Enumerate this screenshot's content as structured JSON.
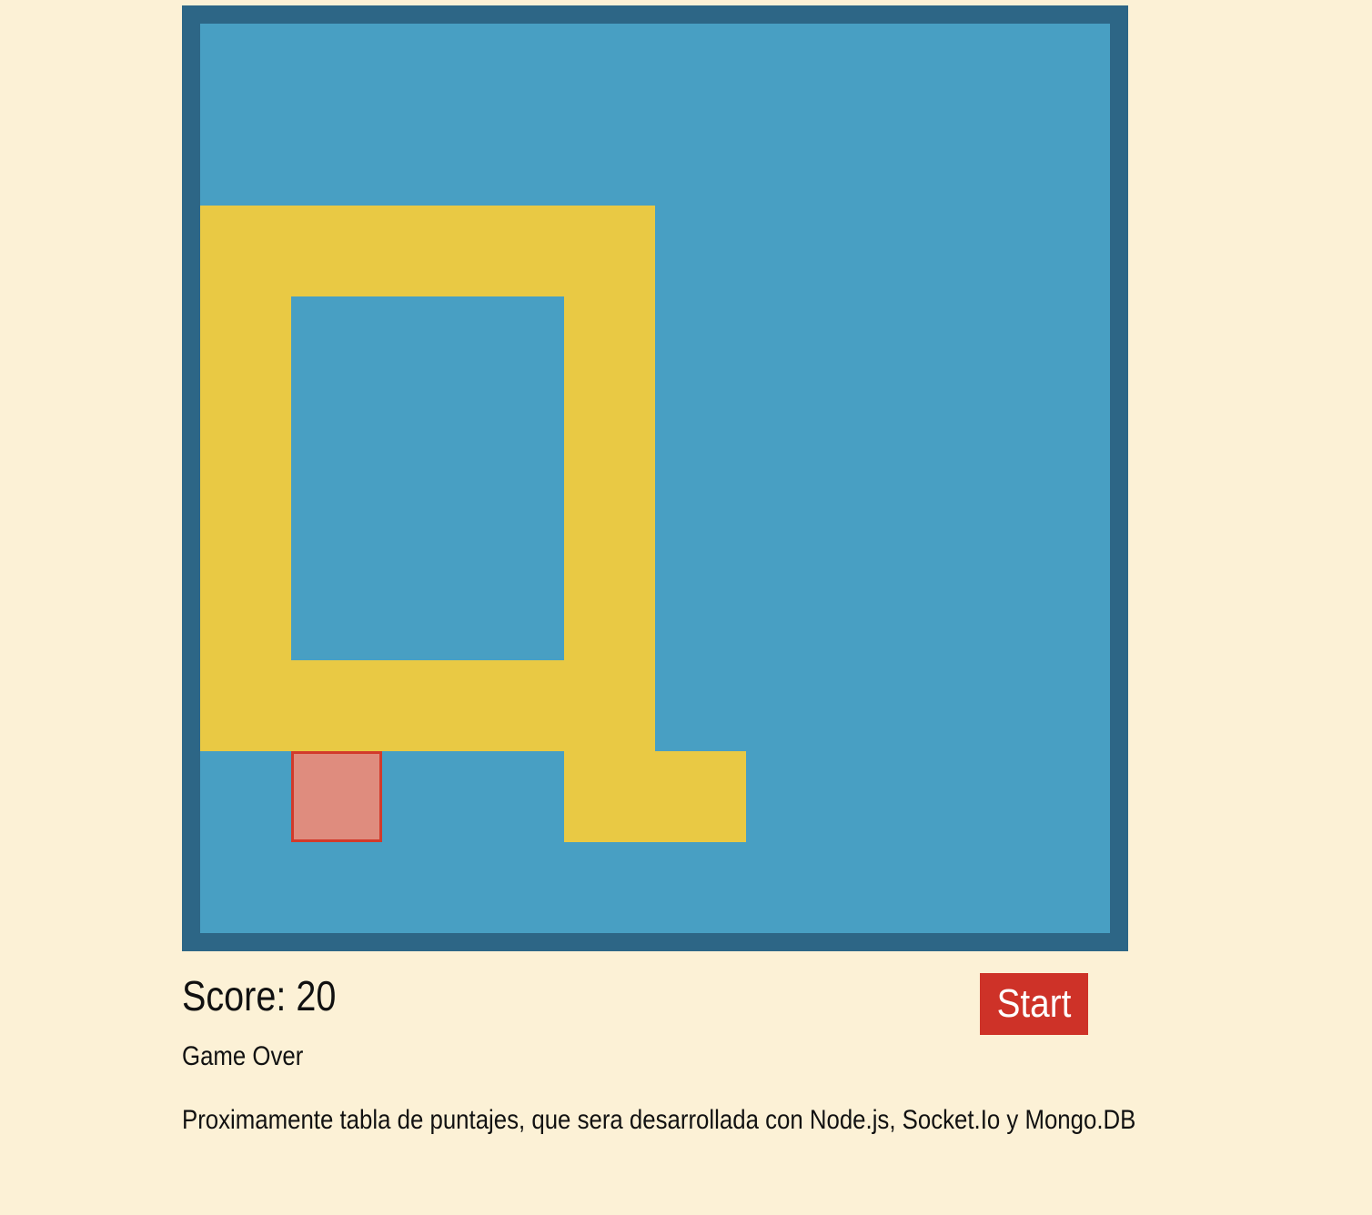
{
  "colors": {
    "page_background": "#fcf1d6",
    "board_border": "#2d6686",
    "board_background": "#489fc3",
    "snake": "#e9c944",
    "food_fill": "#df8c7e",
    "food_border": "#d23a2b",
    "start_button": "#ce3228"
  },
  "board": {
    "grid_columns": 10,
    "grid_rows": 10,
    "snake_cells": [
      [
        0,
        2
      ],
      [
        1,
        2
      ],
      [
        2,
        2
      ],
      [
        3,
        2
      ],
      [
        4,
        2
      ],
      [
        0,
        3
      ],
      [
        4,
        3
      ],
      [
        0,
        4
      ],
      [
        4,
        4
      ],
      [
        0,
        5
      ],
      [
        4,
        5
      ],
      [
        0,
        6
      ],
      [
        4,
        6
      ],
      [
        0,
        7
      ],
      [
        1,
        7
      ],
      [
        2,
        7
      ],
      [
        3,
        7
      ],
      [
        4,
        7
      ],
      [
        4,
        8
      ],
      [
        5,
        8
      ]
    ],
    "food_cell": [
      1,
      8
    ]
  },
  "score": {
    "text": "Score: 20"
  },
  "controls": {
    "start_label": "Start"
  },
  "status": {
    "text": "Game Over"
  },
  "footer": {
    "note": "Proximamente tabla de puntajes, que sera desarrollada con Node.js, Socket.Io y Mongo.DB"
  }
}
